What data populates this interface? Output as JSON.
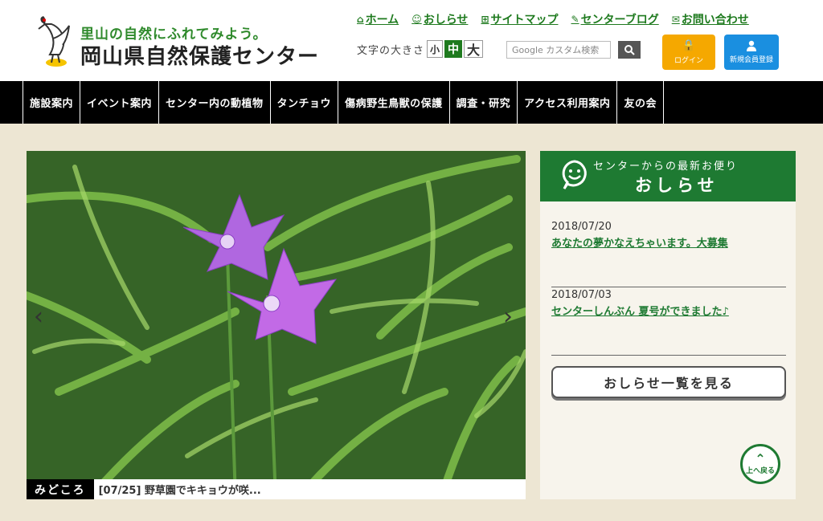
{
  "header": {
    "tagline": "里山の自然にふれてみよう。",
    "site_name": "岡山県自然保護センター",
    "top_links": [
      {
        "label": "ホーム",
        "icon": "home-icon"
      },
      {
        "label": "おしらせ",
        "icon": "smile-icon"
      },
      {
        "label": "サイトマップ",
        "icon": "sitemap-icon"
      },
      {
        "label": "センターブログ",
        "icon": "pencil-icon"
      },
      {
        "label": "お問い合わせ",
        "icon": "mail-icon"
      }
    ],
    "font_size": {
      "label": "文字の大きさ",
      "small": "小",
      "medium": "中",
      "large": "大",
      "selected": "中"
    },
    "search": {
      "placeholder": "Google カスタム検索"
    },
    "login_label": "ログイン",
    "register_label": "新規会員登録"
  },
  "nav": {
    "items": [
      "施設案内",
      "イベント案内",
      "センター内の動植物",
      "タンチョウ",
      "傷病野生鳥獣の保護",
      "調査・研究",
      "アクセス利用案内",
      "友の会"
    ]
  },
  "slider": {
    "caption_tag": "みどころ",
    "caption_text": "[07/25] 野草園でキキョウが咲..."
  },
  "news": {
    "subtitle": "センターからの最新お便り",
    "title": "おしらせ",
    "items": [
      {
        "date": "2018/07/20",
        "title": "あなたの夢かなえちゃいます。大募集"
      },
      {
        "date": "2018/07/03",
        "title": "センターしんぶん 夏号ができました♪"
      }
    ],
    "more_label": "おしらせ一覧を見る"
  },
  "back_to_top": "上へ戻る",
  "colors": {
    "brand_green": "#1e7a32",
    "link_green": "#1e7a1e",
    "login_orange": "#f5a800",
    "register_blue": "#1a8fe0",
    "background": "#ede6d3"
  }
}
